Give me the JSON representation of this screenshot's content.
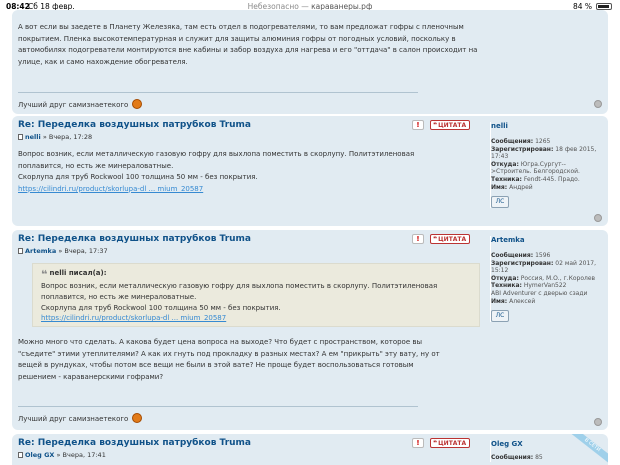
{
  "status_bar": {
    "time": "08:42",
    "date": "Сб 18 февр.",
    "url_prefix": "Небезопасно —",
    "url_domain": "караванеры.рф",
    "battery": "84 %"
  },
  "post1_tail": {
    "text": "А вот если вы заедете в Планету Железяка, там есть отдел в подогревателями, то вам предложат гофры с пленочным покрытием. Пленка высокотемпературная и служит для защиты алюминия гофры от погодных условий, поскольку в автомобилях подогреватели монтируются вне кабины и забор воздуха для нагрева и его \"оттдача\" в салон происходит на улице, как и само нахождение обогревателя.",
    "signature": "Лучший друг самизнаетекого"
  },
  "buttons": {
    "report": "!",
    "quote": "ЦИТАТА",
    "pm": "ЛС"
  },
  "posts": [
    {
      "title": "Re: Переделка воздушных патрубков Truma",
      "author": "nelli",
      "date": "» Вчера, 17:28",
      "lines": [
        "Вопрос возник, если металлическую газовую гофру для выхлопа поместить в скорлупу. Политэтиленовая",
        "поплавится, но есть же минераловатные.",
        "Скорлупа для труб Rockwool 100 толщина 50 мм - без покрытия."
      ],
      "link": "https://cilindri.ru/product/skorlupa-dl ... mium_20587",
      "profile": {
        "name": "nelli",
        "messages_label": "Сообщения:",
        "messages": "1265",
        "registered_label": "Зарегистрирован:",
        "registered": "18 фев 2015, 17:43",
        "from_label": "Откуда:",
        "from": "Югра.Сургут-->Строитель. Белгородской.",
        "tech_label": "Техника:",
        "tech": "Fendt-445. Прадо.",
        "name_label": "Имя:",
        "real_name": "Андрей"
      }
    },
    {
      "title": "Re: Переделка воздушных патрубков Truma",
      "author": "Artemka",
      "date": "» Вчера, 17:37",
      "quote_head": "nelli писал(а):",
      "quote_lines": [
        "Вопрос возник, если металлическую газовую гофру для выхлопа поместить в скорлупу. Политэтиленовая",
        "поплавится, но есть же минераловатные.",
        "Скорлупа для труб Rockwool 100 толщина 50 мм - без покрытия."
      ],
      "quote_link": "https://cilindri.ru/product/skorlupa-dl ... mium_20587",
      "lines": [
        "Можно много что сделать. А какова будет цена вопроса на выходе? Что будет с пространством, которое вы",
        "\"съедите\" этими утеплителями? А как их гнуть под прокладку в разных местах? А ем \"прикрыть\" эту вату, ну от",
        "вещей в рундуках, чтобы потом все вещи не были в этой вате? Не проще будет воспользоваться готовым",
        "решением - караванерскими гофрами?"
      ],
      "signature": "Лучший друг самизнаетекого",
      "profile": {
        "name": "Artemka",
        "messages_label": "Сообщения:",
        "messages": "1596",
        "registered_label": "Зарегистрирован:",
        "registered": "02 май 2017, 15:12",
        "from_label": "Откуда:",
        "from": "Россия, М.О., г.Королев",
        "tech_label": "Техника:",
        "tech": "HymerVan522",
        "extra": "ABI Adventurer с дверью сзади",
        "name_label": "Имя:",
        "real_name": "Алексей"
      }
    },
    {
      "title": "Re: Переделка воздушных патрубков Truma",
      "author": "Oleg GX",
      "date": "» Вчера, 17:41",
      "online": "В СЕТИ",
      "profile": {
        "name": "Oleg GX",
        "messages_label": "Сообщения:",
        "messages": "85"
      }
    }
  ]
}
